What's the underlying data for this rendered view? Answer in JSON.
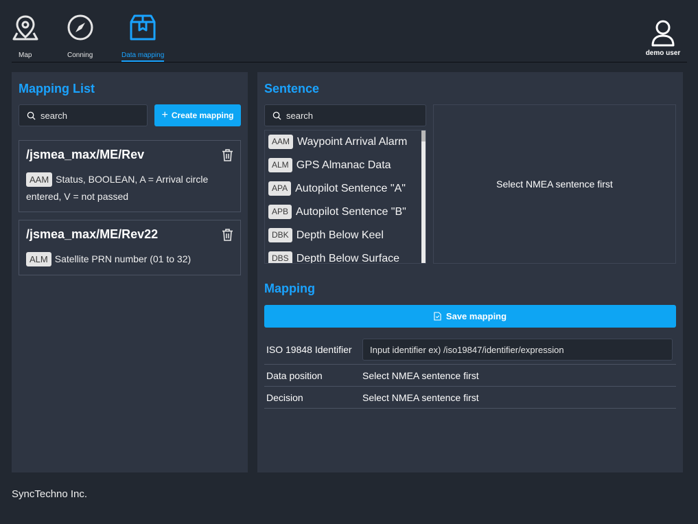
{
  "nav": {
    "items": [
      {
        "label": "Map",
        "icon": "map-pin-icon"
      },
      {
        "label": "Conning",
        "icon": "compass-icon"
      },
      {
        "label": "Data mapping",
        "icon": "box-icon",
        "active": true
      }
    ],
    "user": {
      "label": "demo user",
      "icon": "user-icon"
    }
  },
  "mapping_list": {
    "title": "Mapping List",
    "search_placeholder": "search",
    "create_button": "Create mapping",
    "cards": [
      {
        "title": "/jsmea_max/ME/Rev",
        "tag": "AAM",
        "description": "Status, BOOLEAN, A = Arrival circle entered, V = not passed"
      },
      {
        "title": "/jsmea_max/ME/Rev22",
        "tag": "ALM",
        "description": "Satellite PRN number (01 to 32)"
      }
    ]
  },
  "sentence": {
    "title": "Sentence",
    "search_placeholder": "search",
    "items": [
      {
        "code": "AAM",
        "name": "Waypoint Arrival Alarm"
      },
      {
        "code": "ALM",
        "name": "GPS Almanac Data"
      },
      {
        "code": "APA",
        "name": "Autopilot Sentence \"A\""
      },
      {
        "code": "APB",
        "name": "Autopilot Sentence \"B\""
      },
      {
        "code": "DBK",
        "name": "Depth Below Keel"
      },
      {
        "code": "DBS",
        "name": "Depth Below Surface"
      }
    ],
    "detail_placeholder": "Select NMEA sentence first"
  },
  "mapping": {
    "title": "Mapping",
    "save_button": "Save mapping",
    "rows": {
      "identifier_label": "ISO 19848 Identifier",
      "identifier_placeholder": "Input identifier ex) /iso19847/identifier/expression",
      "data_position_label": "Data position",
      "data_position_value": "Select NMEA sentence first",
      "decision_label": "Decision",
      "decision_value": "Select NMEA sentence first"
    }
  },
  "footer": {
    "company": "SyncTechno Inc."
  },
  "colors": {
    "accent": "#1aa3ff",
    "button": "#0ea5f3",
    "background": "#222831",
    "panel": "#2e3542"
  }
}
